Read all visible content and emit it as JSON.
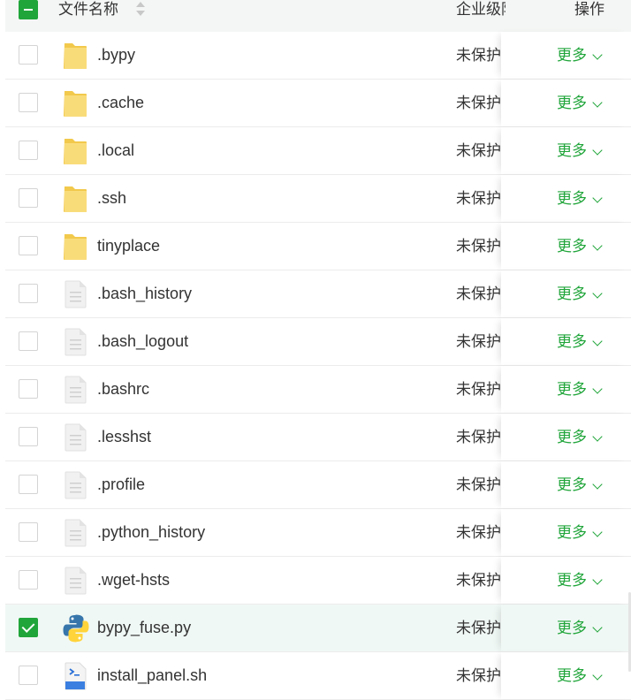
{
  "header": {
    "name_label": "文件名称",
    "level_label": "企业级防",
    "op_label": "操作"
  },
  "colors": {
    "accent": "#20a53a",
    "folder": "#f5d56d",
    "selected_row": "#f0f8f5"
  },
  "rows": [
    {
      "name": ".bypy",
      "type": "folder",
      "level": "未保护",
      "action": "更多",
      "checked": false
    },
    {
      "name": ".cache",
      "type": "folder",
      "level": "未保护",
      "action": "更多",
      "checked": false
    },
    {
      "name": ".local",
      "type": "folder",
      "level": "未保护",
      "action": "更多",
      "checked": false
    },
    {
      "name": ".ssh",
      "type": "folder",
      "level": "未保护",
      "action": "更多",
      "checked": false
    },
    {
      "name": "tinyplace",
      "type": "folder",
      "level": "未保护",
      "action": "更多",
      "checked": false
    },
    {
      "name": ".bash_history",
      "type": "file",
      "level": "未保护",
      "action": "更多",
      "checked": false
    },
    {
      "name": ".bash_logout",
      "type": "file",
      "level": "未保护",
      "action": "更多",
      "checked": false
    },
    {
      "name": ".bashrc",
      "type": "file",
      "level": "未保护",
      "action": "更多",
      "checked": false
    },
    {
      "name": ".lesshst",
      "type": "file",
      "level": "未保护",
      "action": "更多",
      "checked": false
    },
    {
      "name": ".profile",
      "type": "file",
      "level": "未保护",
      "action": "更多",
      "checked": false
    },
    {
      "name": ".python_history",
      "type": "file",
      "level": "未保护",
      "action": "更多",
      "checked": false
    },
    {
      "name": ".wget-hsts",
      "type": "file",
      "level": "未保护",
      "action": "更多",
      "checked": false
    },
    {
      "name": "bypy_fuse.py",
      "type": "python",
      "level": "未保护",
      "action": "更多",
      "checked": true
    },
    {
      "name": "install_panel.sh",
      "type": "shell",
      "level": "未保护",
      "action": "更多",
      "checked": false
    }
  ]
}
